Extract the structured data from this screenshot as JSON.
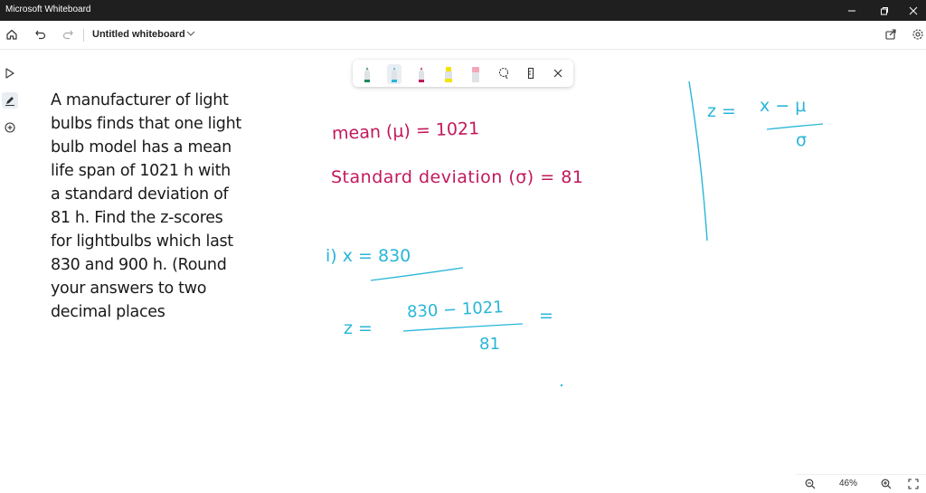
{
  "window": {
    "title": "Microsoft Whiteboard"
  },
  "appbar": {
    "board_name": "Untitled whiteboard"
  },
  "problem": {
    "lines": [
      "A manufacturer of light",
      "bulbs finds that one light",
      "bulb model has a mean",
      "life span of 1021 h with",
      "a standard deviation of",
      "81 h. Find the z-scores",
      "for lightbulbs which last",
      "830 and 900 h. (Round",
      "your answers to two",
      "decimal places"
    ]
  },
  "handwriting": {
    "mean": "mean (μ) = 1021",
    "std": "Standard deviation (σ) = 81",
    "item": "i) x = 830",
    "z_lhs": "z =",
    "z_num": "830 − 1021",
    "z_den": "81",
    "z_eq": "=",
    "formula_lhs": "z =",
    "formula_num": "x − μ",
    "formula_den": "σ"
  },
  "zoom": {
    "level": "46%"
  },
  "colors": {
    "pen_green": "#1e8a5a",
    "pen_cyan": "#29b6d8",
    "pen_red": "#c2185b",
    "pen_yellow": "#f5e300",
    "pen_pink": "#f2a7b8",
    "ink_red": "#c2185b",
    "ink_blue": "#29b6d8"
  }
}
